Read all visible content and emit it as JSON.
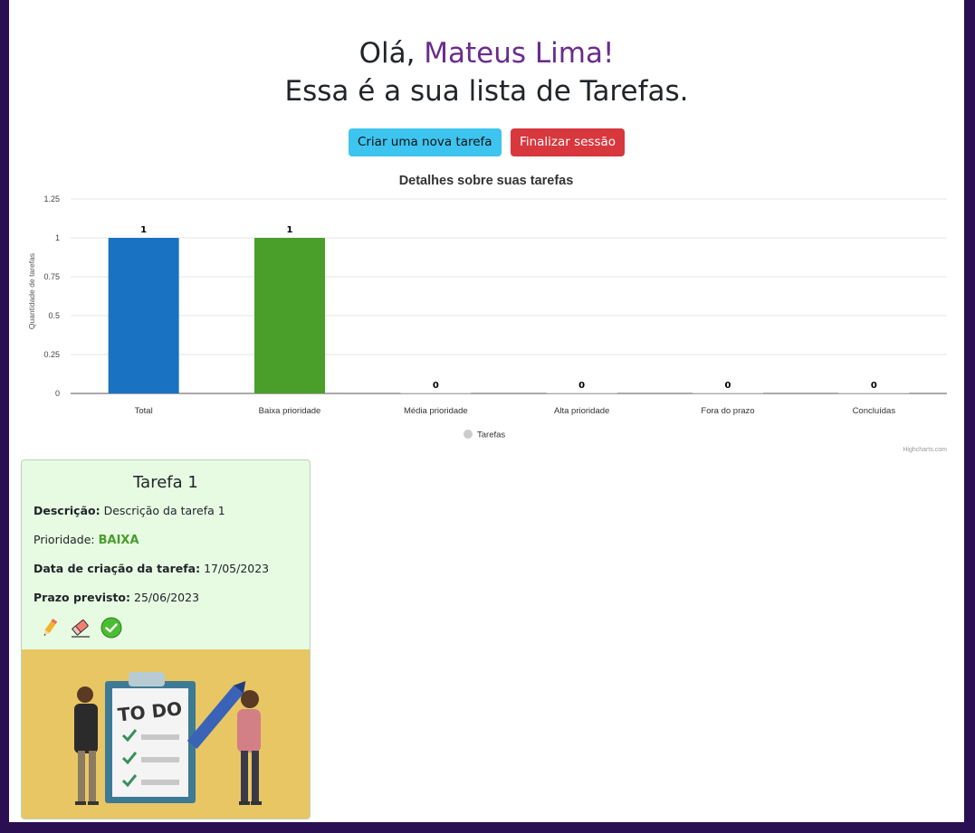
{
  "header": {
    "greeting_prefix": "Olá, ",
    "user_name": "Mateus Lima!",
    "subtitle": "Essa é a sua lista de Tarefas."
  },
  "buttons": {
    "new_task": "Criar uma nova tarefa",
    "logout": "Finalizar sessão"
  },
  "colors": {
    "background": "#2a0f52",
    "name_accent": "#6a2c8c",
    "info_button": "#3dc4ef",
    "danger_button": "#d7373d",
    "card_bg": "#e7fbe3",
    "priority_low": "#4a9d2b"
  },
  "chart_data": {
    "type": "bar",
    "title": "Detalhes sobre suas tarefas",
    "ylabel": "Quantidade de tarefas",
    "xlabel": "",
    "categories": [
      "Total",
      "Baixa prioridade",
      "Média prioridade",
      "Alta prioridade",
      "Fora do prazo",
      "Concluídas"
    ],
    "series": [
      {
        "name": "Tarefas",
        "values": [
          1,
          1,
          0,
          0,
          0,
          0
        ],
        "colors": [
          "#1a72c2",
          "#4a9f2a",
          "#1a72c2",
          "#d7373d",
          "#888888",
          "#1a72c2"
        ]
      }
    ],
    "yticks": [
      "0",
      "0.25",
      "0.5",
      "0.75",
      "1",
      "1.25"
    ],
    "ylim": [
      0,
      1.25
    ],
    "grid": true,
    "legend": "bottom-center",
    "credits": "Highcharts.com"
  },
  "task": {
    "title": "Tarefa 1",
    "description_label": "Descrição:",
    "description": "Descrição da tarefa 1",
    "priority_label": "Prioridade:",
    "priority": "BAIXA",
    "created_label": "Data de criação da tarefa:",
    "created": "17/05/2023",
    "deadline_label": "Prazo previsto:",
    "deadline": "25/06/2023",
    "icons": [
      "pencil-icon",
      "eraser-icon",
      "check-circle-icon"
    ],
    "image_text": "TO DO"
  }
}
